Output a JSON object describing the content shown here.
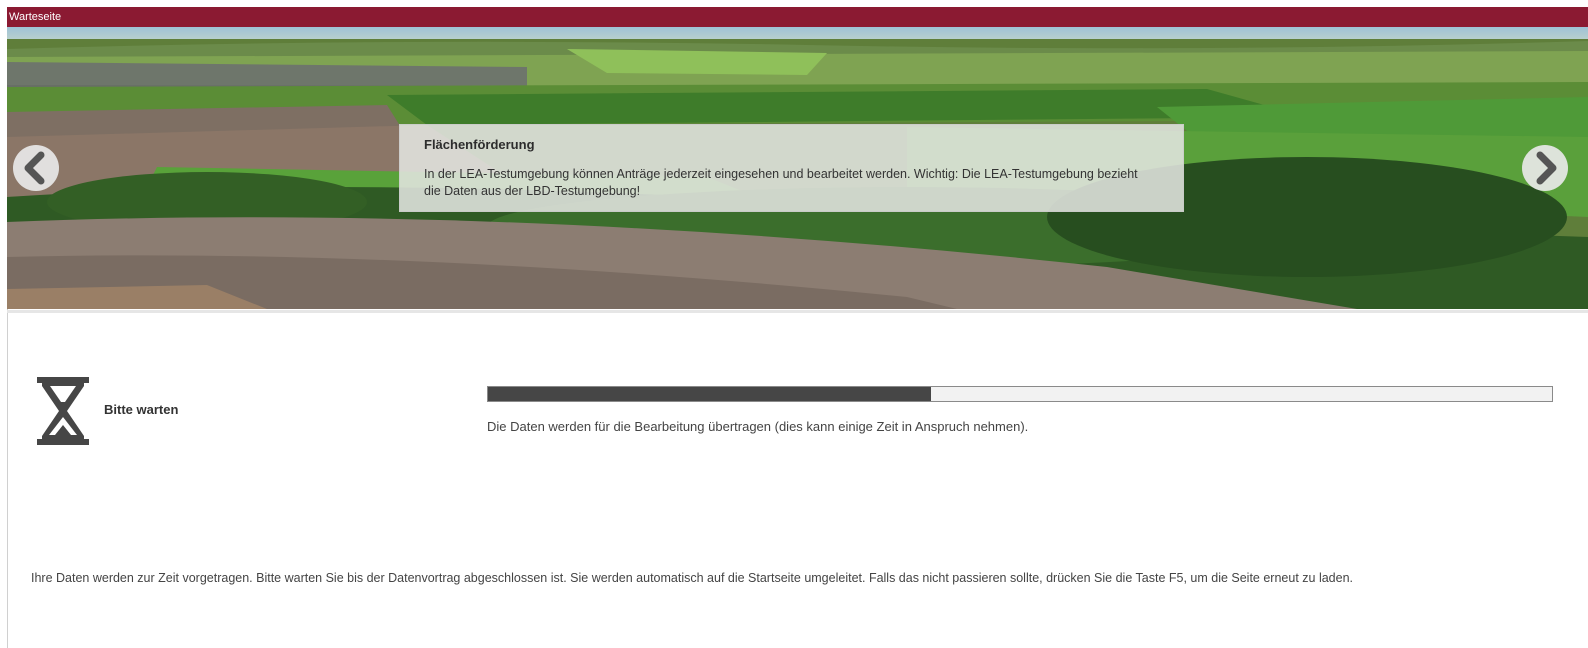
{
  "window": {
    "title": "Warteseite"
  },
  "slider": {
    "caption_title": "Flächenförderung",
    "caption_text": "In der LEA-Testumgebung können Anträge jederzeit eingesehen und bearbeitet werden. Wichtig: Die LEA-Testumgebung bezieht die Daten aus der LBD-Testumgebung!",
    "prev_icon": "chevron-left-icon",
    "next_icon": "chevron-right-icon"
  },
  "status": {
    "icon": "hourglass-icon",
    "label": "Bitte warten",
    "progress_fraction": 0.416,
    "progress_text": "Die Daten werden für die Bearbeitung übertragen (dies kann einige Zeit in Anspruch nehmen)."
  },
  "info": {
    "text": "Ihre Daten werden zur Zeit vorgetragen. Bitte warten Sie bis der Datenvortrag abgeschlossen ist. Sie werden automatisch auf die Startseite umgeleitet. Falls das nicht passieren sollte, drücken Sie die Taste F5, um die Seite erneut zu laden."
  },
  "colors": {
    "titlebar": "#8b1a32",
    "progress_fill": "#464646",
    "progress_track": "#f2f2f2"
  }
}
